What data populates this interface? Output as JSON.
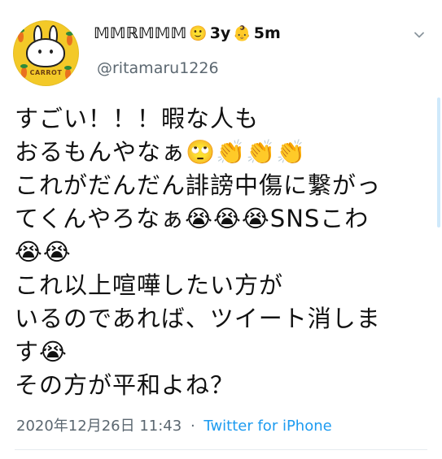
{
  "tweet": {
    "display_name": "𝕄𝕄ℝ𝕄𝕄𝕄",
    "badge1": "🙂",
    "age1": "3y",
    "badge2": "👶",
    "age2": "5m",
    "handle": "@ritamaru1226",
    "avatar_text": "CARROT",
    "lines": [
      "すごい！！！暇な人も",
      "おるもんやなぁ🙄👏👏👏",
      "これがだんだん誹謗中傷に繋がっ",
      "てくんやろなぁ😭😭😭SNSこわ",
      "😭😭",
      "これ以上喧嘩したい方が",
      "いるのであれば、ツイート消しま",
      "す😭",
      "その方が平和よね？"
    ],
    "timestamp": "2020年12月26日 11:43",
    "separator": "·",
    "source": "Twitter for iPhone"
  },
  "colors": {
    "accent": "#1d9bf0",
    "secondary_text": "#5b6770",
    "avatar_bg": "#f3c928"
  },
  "icons": {
    "menu": "chevron-down-icon"
  }
}
